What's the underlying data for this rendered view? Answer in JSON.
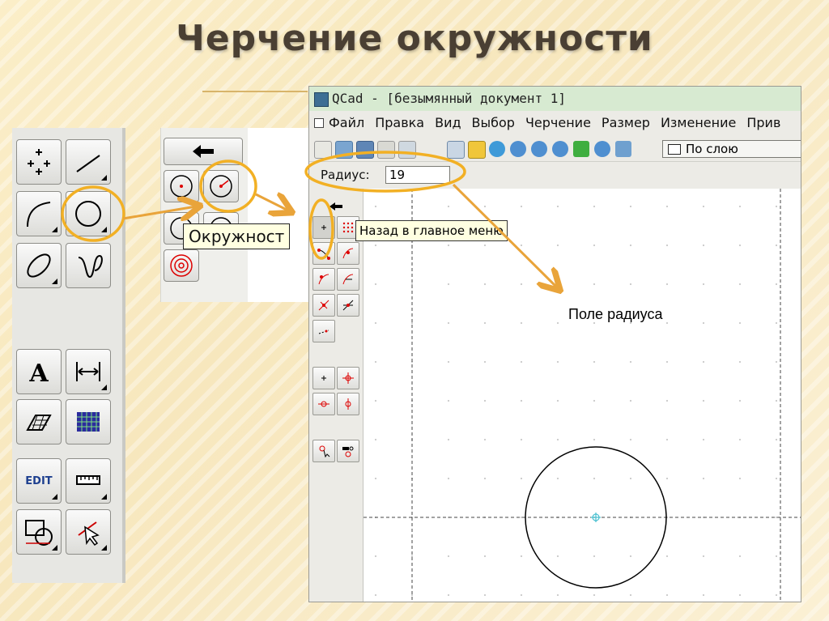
{
  "slide": {
    "title": "Черчение окружности",
    "annotation": "Поле радиуса"
  },
  "left_toolbar": {
    "icons": [
      "points-icon",
      "line-icon",
      "arc-icon",
      "circle-icon",
      "ellipse-icon",
      "spline-icon",
      "text-icon",
      "dimension-icon",
      "hatch-icon",
      "image-icon",
      "edit-icon",
      "measure-icon",
      "block-icon",
      "select-icon"
    ]
  },
  "circle_submenu": {
    "tooltip": "Окружност",
    "icons": [
      "back-arrow-icon",
      "circle-center-point-icon",
      "circle-center-radius-icon",
      "circle-2-points-icon",
      "circle-3-points-icon",
      "concentric-circle-icon"
    ]
  },
  "qcad": {
    "title": "QCad - [безымянный документ 1]",
    "menu": [
      "Файл",
      "Правка",
      "Вид",
      "Выбор",
      "Черчение",
      "Размер",
      "Изменение",
      "Прив"
    ],
    "toolbar_icons": [
      "new-file-icon",
      "open-file-icon",
      "save-file-icon",
      "print-icon",
      "print-preview-icon",
      "grid-toggle-icon",
      "pencil-icon",
      "redraw-icon",
      "zoom-in-icon",
      "zoom-out-icon",
      "zoom-auto-icon",
      "zoom-previous-icon",
      "zoom-window-icon",
      "pan-icon"
    ],
    "layer_select": "По слою",
    "options": {
      "radius_label": "Радиус:",
      "radius_value": "19"
    },
    "back_tooltip": "Назад в главное меню"
  },
  "colors": {
    "highlight": "#f2b024",
    "arrow": "#e9a43a",
    "titlebar": "#d7ead1"
  }
}
